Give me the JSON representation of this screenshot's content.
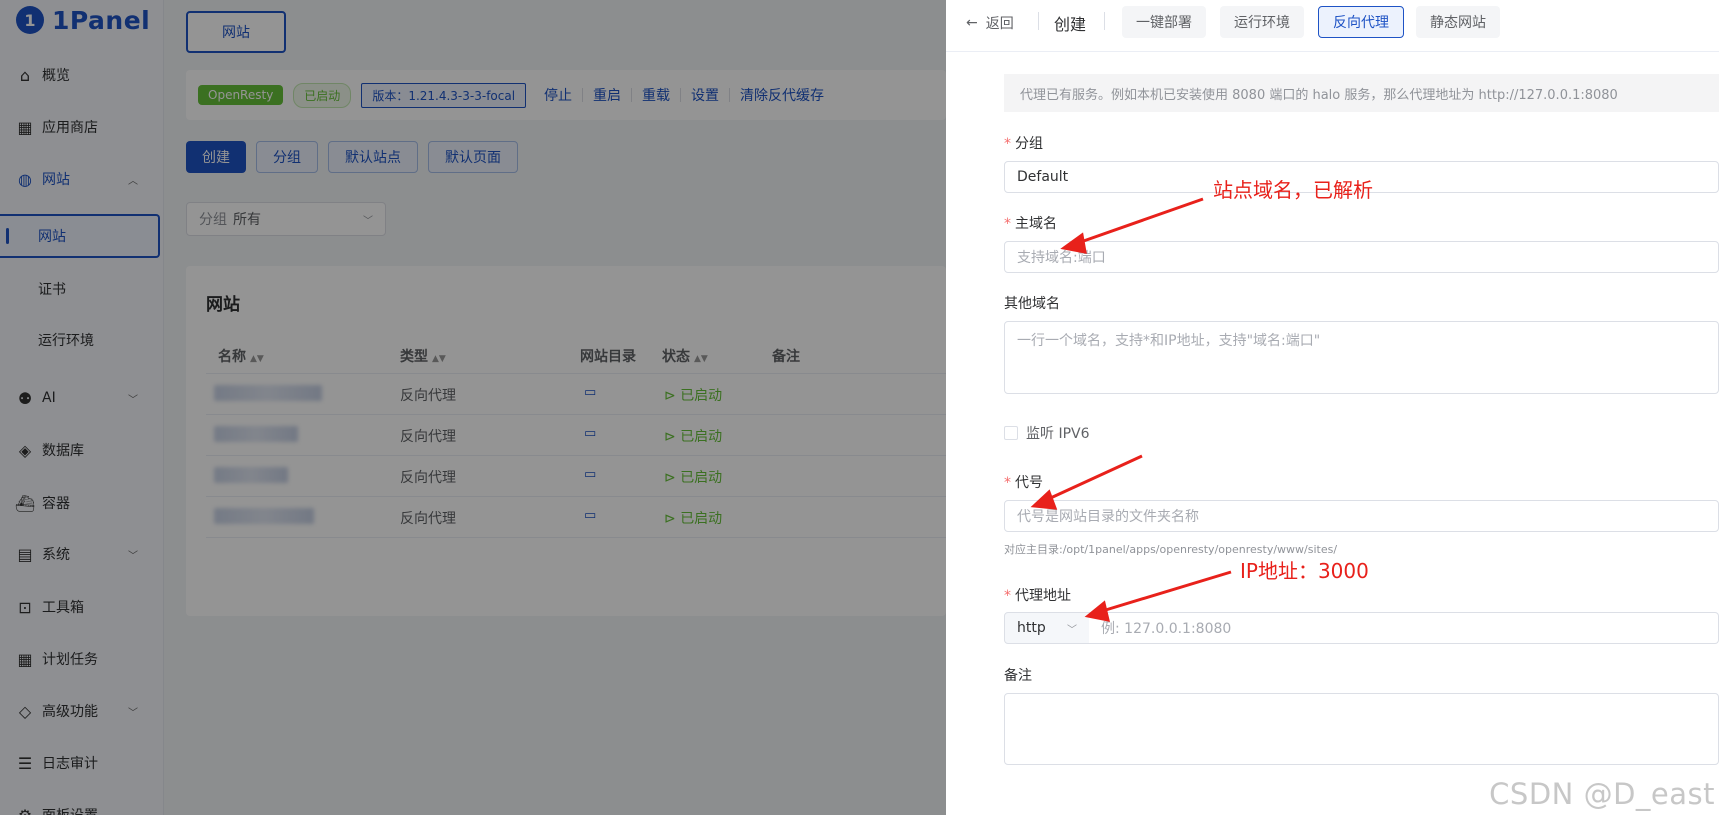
{
  "app": {
    "logo_text": "1Panel",
    "logo_glyph": "1"
  },
  "sidebar": {
    "items": [
      {
        "label": "概览",
        "icon": "home-icon"
      },
      {
        "label": "应用商店",
        "icon": "grid-icon"
      },
      {
        "label": "网站",
        "icon": "globe-icon"
      },
      {
        "label": "AI",
        "icon": "robot-icon"
      },
      {
        "label": "数据库",
        "icon": "layers-icon"
      },
      {
        "label": "容器",
        "icon": "docker-icon"
      },
      {
        "label": "系统",
        "icon": "server-icon"
      },
      {
        "label": "工具箱",
        "icon": "toolbox-icon"
      },
      {
        "label": "计划任务",
        "icon": "calendar-icon"
      },
      {
        "label": "高级功能",
        "icon": "diamond-icon"
      },
      {
        "label": "日志审计",
        "icon": "log-icon"
      },
      {
        "label": "面板设置",
        "icon": "settings-icon"
      }
    ],
    "sub_items": [
      "网站",
      "证书",
      "运行环境"
    ]
  },
  "main": {
    "tab_label": "网站",
    "status": {
      "app": "OpenResty",
      "state": "已启动",
      "version": "版本：1.21.4.3-3-3-focal",
      "links": [
        "停止",
        "重启",
        "重载",
        "设置",
        "清除反代缓存"
      ]
    },
    "actions": [
      "创建",
      "分组",
      "默认站点",
      "默认页面"
    ],
    "filter": {
      "label": "分组",
      "value": "所有"
    },
    "table": {
      "title": "网站",
      "columns": [
        "名称",
        "类型",
        "网站目录",
        "状态",
        "备注"
      ],
      "rows": [
        {
          "type": "反向代理",
          "status": "已启动"
        },
        {
          "type": "反向代理",
          "status": "已启动"
        },
        {
          "type": "反向代理",
          "status": "已启动"
        },
        {
          "type": "反向代理",
          "status": "已启动"
        }
      ]
    }
  },
  "drawer": {
    "back": "返回",
    "title": "创建",
    "tabs": [
      "一键部署",
      "运行环境",
      "反向代理",
      "静态网站"
    ],
    "active_tab": "反向代理",
    "hint": "代理已有服务。例如本机已安装使用 8080 端口的 halo 服务，那么代理地址为 http://127.0.0.1:8080",
    "group": {
      "label": "分组",
      "value": "Default"
    },
    "primary_domain": {
      "label": "主域名",
      "placeholder": "支持域名:端口"
    },
    "other_domains": {
      "label": "其他域名",
      "placeholder": "一行一个域名，支持*和IP地址，支持\"域名:端口\""
    },
    "ipv6": {
      "label": "监听 IPV6"
    },
    "alias": {
      "label": "代号",
      "placeholder": "代号是网站目录的文件夹名称",
      "hint": "对应主目录:/opt/1panel/apps/openresty/openresty/www/sites/"
    },
    "proxy": {
      "label": "代理地址",
      "protocol": "http",
      "placeholder": "例: 127.0.0.1:8080"
    },
    "remark": {
      "label": "备注"
    }
  },
  "annotations": {
    "domain_note": "站点域名，已解析",
    "ip_note": "IP地址：3000",
    "color": "#e8211b"
  },
  "watermark": "CSDN @D_east",
  "colors": {
    "primary": "#1e53c5",
    "success": "#67c23a",
    "danger": "#f56c6c"
  }
}
